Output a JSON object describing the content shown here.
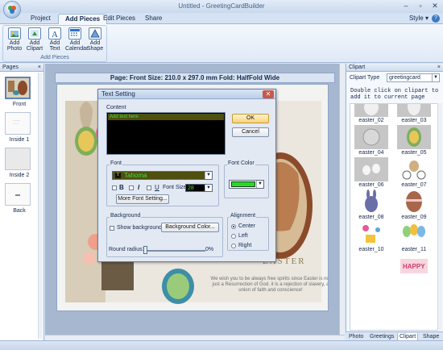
{
  "window": {
    "title": "Untitled - GreetingCardBuilder",
    "controls": [
      "–",
      "▫",
      "✕"
    ]
  },
  "menu": {
    "tabs": [
      {
        "label": "Project",
        "active": false
      },
      {
        "label": "Add Pieces",
        "active": true
      },
      {
        "label": "Edit Pieces",
        "active": false
      },
      {
        "label": "Share",
        "active": false
      }
    ],
    "style_label": "Style ▾"
  },
  "ribbon": {
    "group_label": "Add Pieces",
    "buttons": [
      {
        "label": "Add Photo",
        "icon": "photo-icon"
      },
      {
        "label": "Add Clipart",
        "icon": "clipart-icon"
      },
      {
        "label": "Add Text",
        "icon": "text-icon"
      },
      {
        "label": "Add Calendar",
        "icon": "calendar-icon"
      },
      {
        "label": "Add Shape",
        "icon": "shape-icon"
      }
    ]
  },
  "pages_panel": {
    "title": "Pages",
    "pages": [
      "Front",
      "Inside 1",
      "Inside 2",
      "Back"
    ]
  },
  "document": {
    "info": "Page: Front  Size: 210.0 x 297.0 mm  Fold: HalfFold Wide",
    "easter_text": "EASTER",
    "verse": "We wish you to be always free spirits since Easter is not just a Resurrection of God. it is a rejection of slavery, a union of faith and conscience!"
  },
  "dialog": {
    "title": "Text Setting",
    "content_label": "Content",
    "content_text": "Add text here",
    "ok_label": "OK",
    "cancel_label": "Cancel",
    "font_group": "Font",
    "font_name": "Tahoma",
    "bold_label": "B",
    "italic_label": "I",
    "underline_label": "U",
    "font_size_label": "Font Size",
    "font_size_value": "28",
    "more_font_label": "More Font Setting...",
    "font_color_group": "Font Color",
    "font_color": "#22dd22",
    "background_group": "Background",
    "show_background_label": "Show background",
    "background_color_label": "Background Color...",
    "round_radius_label": "Round radius:",
    "round_radius_value": "0%",
    "alignment_group": "Alignment",
    "align_options": [
      "Center",
      "Left",
      "Right"
    ],
    "align_selected": "Center"
  },
  "clipart_panel": {
    "title": "Clipart",
    "type_label": "Clipart Type",
    "type_value": "greetingcard",
    "hint": "Double click on clipart to add it to current page",
    "items": [
      "easter_02",
      "easter_03",
      "easter_04",
      "easter_05",
      "easter_06",
      "easter_07",
      "easter_08",
      "easter_09",
      "easter_10",
      "easter_11"
    ],
    "tabs": [
      {
        "label": "Photo",
        "active": false
      },
      {
        "label": "Greetings",
        "active": false
      },
      {
        "label": "Clipart",
        "active": true
      },
      {
        "label": "Shape",
        "active": false
      }
    ]
  }
}
